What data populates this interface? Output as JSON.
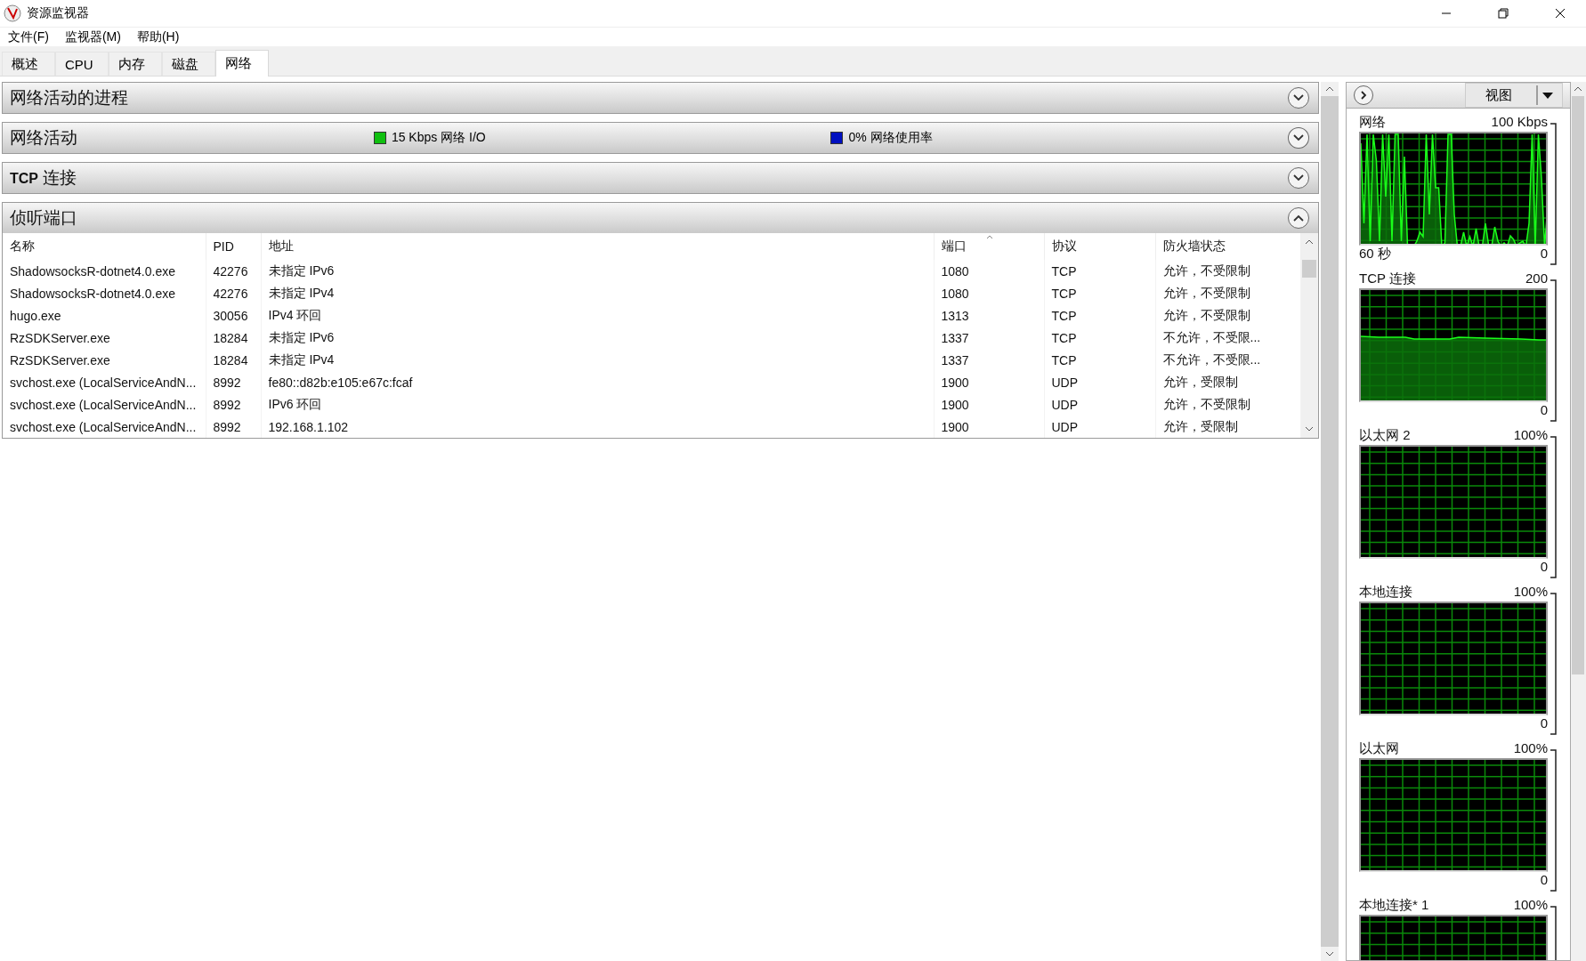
{
  "window": {
    "title": "资源监视器"
  },
  "menu": [
    "文件(F)",
    "监视器(M)",
    "帮助(H)"
  ],
  "tabs": [
    {
      "label": "概述",
      "selected": false
    },
    {
      "label": "CPU",
      "selected": false
    },
    {
      "label": "内存",
      "selected": false
    },
    {
      "label": "磁盘",
      "selected": false
    },
    {
      "label": "网络",
      "selected": true
    }
  ],
  "sections": [
    {
      "title": "网络活动的进程",
      "expanded": false
    },
    {
      "title": "网络活动",
      "expanded": false,
      "legend": [
        {
          "text": "15 Kbps 网络 I/O",
          "color": "#10c010"
        },
        {
          "text": "0% 网络使用率",
          "color": "#0010c0"
        }
      ]
    },
    {
      "title": "**TCP** 连接",
      "expanded": false
    },
    {
      "title": "侦听端口",
      "expanded": true
    }
  ],
  "listening_ports": {
    "columns": [
      {
        "label": "名称",
        "sorted": false
      },
      {
        "label": "PID",
        "sorted": false
      },
      {
        "label": "地址",
        "sorted": false
      },
      {
        "label": "端口",
        "sorted": true
      },
      {
        "label": "协议",
        "sorted": false
      },
      {
        "label": "防火墙状态",
        "sorted": false
      }
    ],
    "rows": [
      [
        "ShadowsocksR-dotnet4.0.exe",
        "42276",
        "未指定 IPv6",
        "1080",
        "TCP",
        "允许，不受限制"
      ],
      [
        "ShadowsocksR-dotnet4.0.exe",
        "42276",
        "未指定 IPv4",
        "1080",
        "TCP",
        "允许，不受限制"
      ],
      [
        "hugo.exe",
        "30056",
        "IPv4 环回",
        "1313",
        "TCP",
        "允许，不受限制"
      ],
      [
        "RzSDKServer.exe",
        "18284",
        "未指定 IPv6",
        "1337",
        "TCP",
        "不允许，不受限..."
      ],
      [
        "RzSDKServer.exe",
        "18284",
        "未指定 IPv4",
        "1337",
        "TCP",
        "不允许，不受限..."
      ],
      [
        "svchost.exe (LocalServiceAndN...",
        "8992",
        "fe80::d82b:e105:e67c:fcaf",
        "1900",
        "UDP",
        "允许，受限制"
      ],
      [
        "svchost.exe (LocalServiceAndN...",
        "8992",
        "IPv6 环回",
        "1900",
        "UDP",
        "允许，不受限制"
      ],
      [
        "svchost.exe (LocalServiceAndN...",
        "8992",
        "192.168.1.102",
        "1900",
        "UDP",
        "允许，受限制"
      ]
    ]
  },
  "side_panel": {
    "view_button": "视图",
    "graphs": [
      {
        "title": "网络",
        "max": "100 Kbps",
        "min": "0",
        "footer_left": "60 秒",
        "kind": "spiky"
      },
      {
        "title": "TCP 连接",
        "max": "200",
        "min": "0",
        "kind": "flat"
      },
      {
        "title": "以太网 2",
        "max": "100%",
        "min": "0",
        "kind": "empty"
      },
      {
        "title": "本地连接",
        "max": "100%",
        "min": "0",
        "kind": "empty"
      },
      {
        "title": "以太网",
        "max": "100%",
        "min": "0",
        "kind": "empty"
      },
      {
        "title": "本地连接* 1",
        "max": "100%",
        "kind": "empty"
      }
    ]
  }
}
